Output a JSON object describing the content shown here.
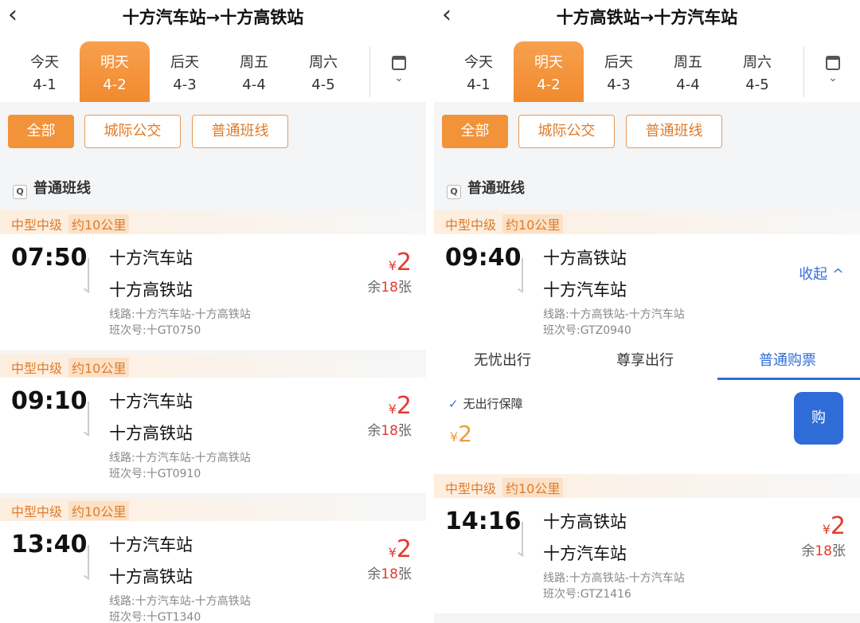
{
  "left": {
    "title": "十方汽车站→十方高铁站",
    "dates": [
      {
        "day": "今天",
        "date": "4-1"
      },
      {
        "day": "明天",
        "date": "4-2"
      },
      {
        "day": "后天",
        "date": "4-3"
      },
      {
        "day": "周五",
        "date": "4-4"
      },
      {
        "day": "周六",
        "date": "4-5"
      }
    ],
    "filters": [
      "全部",
      "城际公交",
      "普通班线"
    ],
    "section": "普通班线",
    "trips": [
      {
        "tag1": "中型中级",
        "tag2": "约10公里",
        "time": "07:50",
        "from": "十方汽车站",
        "to": "十方高铁站",
        "route": "线路:十方汽车站-十方高铁站",
        "code": "班次号:十GT0750",
        "price": "2",
        "remain_pre": "余",
        "remain_num": "18",
        "remain_post": "张"
      },
      {
        "tag1": "中型中级",
        "tag2": "约10公里",
        "time": "09:10",
        "from": "十方汽车站",
        "to": "十方高铁站",
        "route": "线路:十方汽车站-十方高铁站",
        "code": "班次号:十GT0910",
        "price": "2",
        "remain_pre": "余",
        "remain_num": "18",
        "remain_post": "张"
      },
      {
        "tag1": "中型中级",
        "tag2": "约10公里",
        "time": "13:40",
        "from": "十方汽车站",
        "to": "十方高铁站",
        "route": "线路:十方汽车站-十方高铁站",
        "code": "班次号:十GT1340",
        "price": "2",
        "remain_pre": "余",
        "remain_num": "18",
        "remain_post": "张"
      }
    ]
  },
  "right": {
    "title": "十方高铁站→十方汽车站",
    "dates": [
      {
        "day": "今天",
        "date": "4-1"
      },
      {
        "day": "明天",
        "date": "4-2"
      },
      {
        "day": "后天",
        "date": "4-3"
      },
      {
        "day": "周五",
        "date": "4-4"
      },
      {
        "day": "周六",
        "date": "4-5"
      }
    ],
    "filters": [
      "全部",
      "城际公交",
      "普通班线"
    ],
    "section": "普通班线",
    "expanded_trip": {
      "tag1": "中型中级",
      "tag2": "约10公里",
      "time": "09:40",
      "from": "十方高铁站",
      "to": "十方汽车站",
      "route": "线路:十方高铁站-十方汽车站",
      "code": "班次号:GTZ0940",
      "collapse": "收起 ^"
    },
    "ticket_tabs": [
      "无忧出行",
      "尊享出行",
      "普通购票"
    ],
    "detail": {
      "check": "无出行保障",
      "price": "2",
      "buy": "购"
    },
    "trip2": {
      "tag1": "中型中级",
      "tag2": "约10公里",
      "time": "14:16",
      "from": "十方高铁站",
      "to": "十方汽车站",
      "route": "线路:十方高铁站-十方汽车站",
      "code": "班次号:GTZ1416",
      "price": "2",
      "remain_pre": "余",
      "remain_num": "18",
      "remain_post": "张"
    }
  },
  "currency": "¥",
  "colors": {
    "accent": "#f29239",
    "price": "#e23b2e",
    "link": "#2f6cd8"
  }
}
